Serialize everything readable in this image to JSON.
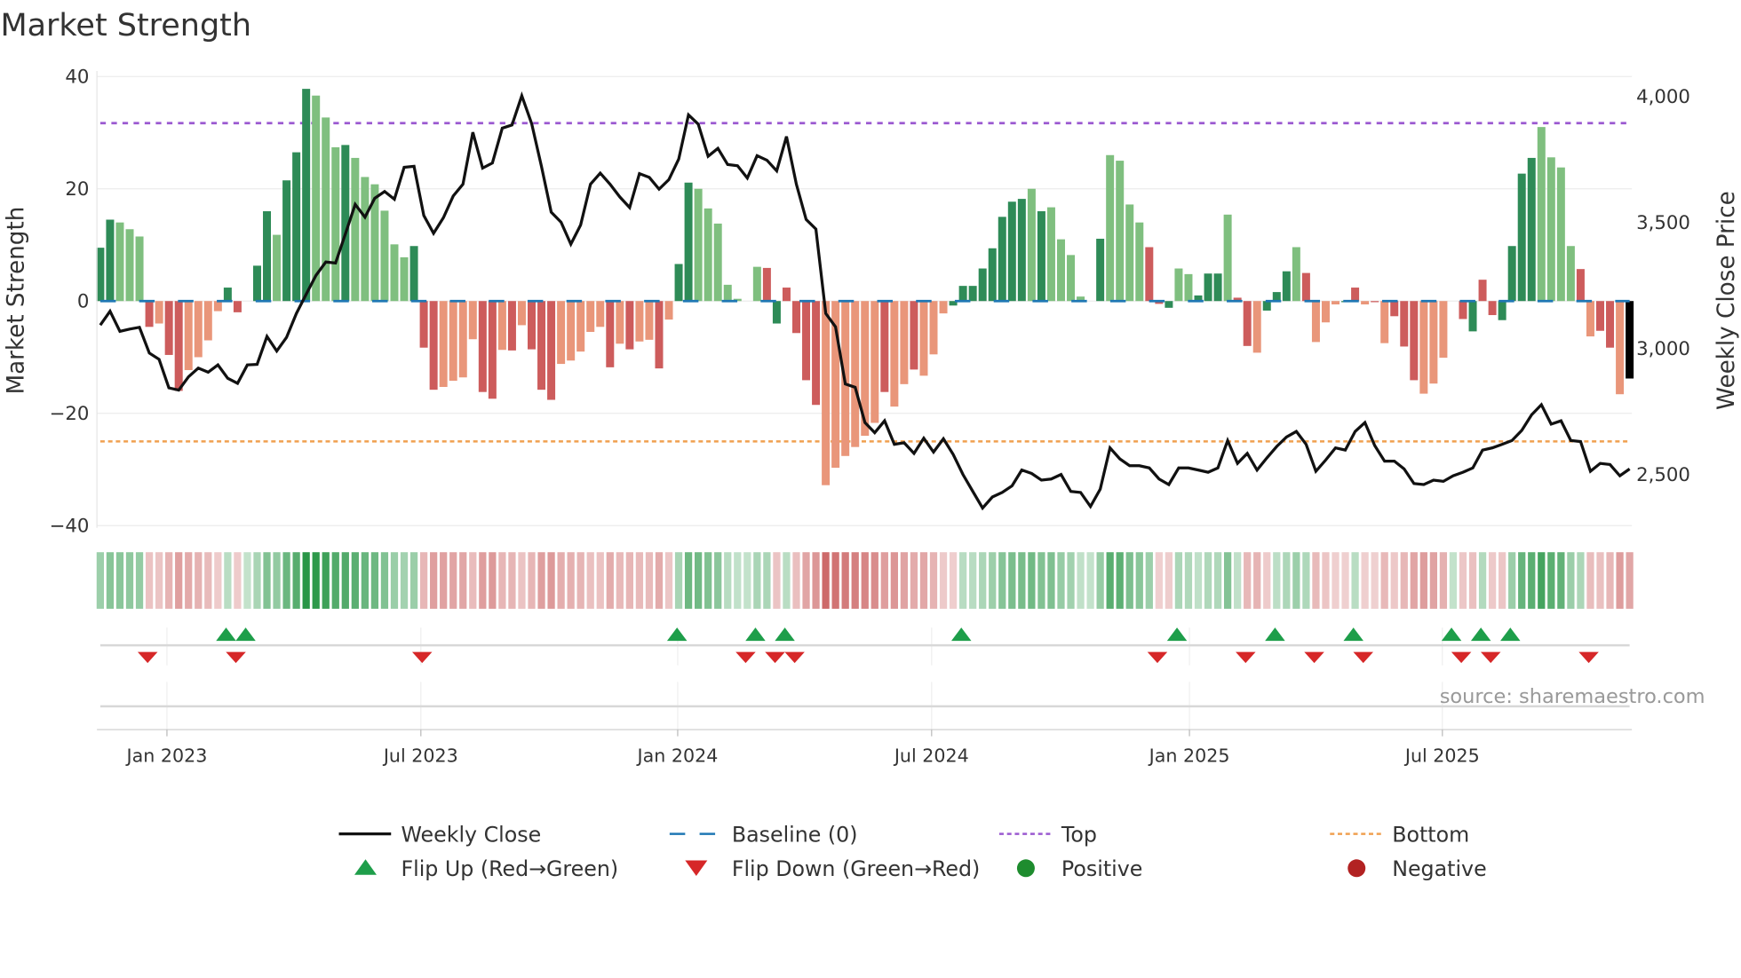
{
  "title": "Market Strength",
  "source": "source: sharemaestro.com",
  "chart_data": {
    "type": "bar+line",
    "title": "Market Strength",
    "ylabel": "Market Strength",
    "y2label": "Weekly Close Price",
    "ylim": [
      -40,
      40
    ],
    "y2lim": [
      2380,
      4080
    ],
    "yticks": [
      40,
      20,
      0,
      -20,
      -40
    ],
    "ytick_labels": [
      "40",
      "20",
      "0",
      "−20",
      "−40"
    ],
    "y2ticks": [
      4000,
      3500,
      3000,
      2500
    ],
    "y2tick_labels": [
      "4,000",
      "3,500",
      "3,000",
      "2,500"
    ],
    "x_unit": "week index (weekly, ~Nov 2022 to Oct 2025)",
    "xticks": [
      {
        "week": 6.8,
        "label": "Jan 2023"
      },
      {
        "week": 32.7,
        "label": "Jul 2023"
      },
      {
        "week": 58.9,
        "label": "Jan 2024"
      },
      {
        "week": 84.8,
        "label": "Jul 2024"
      },
      {
        "week": 111.1,
        "label": "Jan 2025"
      },
      {
        "week": 136.9,
        "label": "Jul 2025"
      }
    ],
    "top_level": 31.7,
    "bottom_level": -25,
    "baseline": 0,
    "strength": [
      9.5,
      14.5,
      14,
      12.8,
      11.5,
      -4.6,
      -4,
      -9.6,
      -16,
      -12.3,
      -10,
      -7,
      -1.8,
      2.4,
      -2,
      0,
      6.3,
      16,
      11.8,
      21.5,
      26.5,
      37.8,
      36.6,
      32.7,
      27.4,
      27.8,
      25.5,
      22.1,
      20.8,
      16.1,
      10.1,
      7.8,
      9.8,
      -8.3,
      -15.8,
      -15.3,
      -14.2,
      -13.6,
      -6.8,
      -16.2,
      -17.4,
      -8.7,
      -8.8,
      -4.3,
      -8.6,
      -15.8,
      -17.6,
      -11.2,
      -10.6,
      -9,
      -5.5,
      -4.6,
      -11.8,
      -7.6,
      -8.6,
      -7.2,
      -6.9,
      -12,
      -3.3,
      6.6,
      21.1,
      20,
      16.5,
      13.8,
      2.9,
      0.4,
      0,
      6.1,
      5.9,
      -4,
      2.4,
      -5.7,
      -14.1,
      -18.5,
      -32.8,
      -29.7,
      -27.6,
      -26,
      -24,
      -21.7,
      -16.2,
      -18.8,
      -14.8,
      -12.2,
      -13.3,
      -9.5,
      -2.2,
      -0.8,
      2.7,
      2.7,
      5.8,
      9.4,
      15,
      17.7,
      18.2,
      20,
      16,
      16.7,
      11,
      8.2,
      0.8,
      0,
      11.1,
      26,
      25,
      17.2,
      14,
      9.6,
      -0.5,
      -1.2,
      5.8,
      4.8,
      1,
      4.9,
      4.9,
      15.4,
      0.6,
      -8,
      -9.2,
      -1.7,
      1.6,
      5.3,
      9.6,
      5,
      -7.3,
      -3.8,
      -0.6,
      -0.2,
      2.4,
      -0.6,
      -0.2,
      -7.5,
      -2.7,
      -8.1,
      -14.1,
      -16.5,
      -14.7,
      -10.1,
      0,
      -3.2,
      -5.4,
      3.8,
      -2.5,
      -3.4,
      9.8,
      22.7,
      25.5,
      31,
      25.6,
      23.8,
      9.8,
      5.7,
      -6.3,
      -5.3,
      -8.3,
      -16.6,
      -13.8
    ],
    "bar_state": "GGgggRrRRrrrrGRGGGgGGGgggGggggggGRRrrrrRRrRrRRRrrrrrRrRrrRrGGgggggGgRGRRRRrrrrrrRrrRrrrGGGGGGGGgGggggGGggggRRGggGGGgRRrGGGgRrrrGRrRrRRRrrrRRGRRGGGGggggRrRRr",
    "bar_state_legend": {
      "G": "positive rising",
      "g": "positive falling",
      "R": "negative falling",
      "r": "negative rising"
    },
    "weekly_close": [
      3093,
      3148,
      3068,
      3077,
      3084,
      2982,
      2957,
      2844,
      2835,
      2888,
      2922,
      2906,
      2935,
      2882,
      2862,
      2935,
      2937,
      3048,
      2990,
      3044,
      3139,
      3215,
      3290,
      3343,
      3339,
      3454,
      3572,
      3521,
      3596,
      3623,
      3592,
      3719,
      3723,
      3528,
      3457,
      3519,
      3605,
      3652,
      3858,
      3716,
      3736,
      3874,
      3887,
      4003,
      3892,
      3723,
      3541,
      3501,
      3414,
      3490,
      3652,
      3696,
      3652,
      3601,
      3559,
      3694,
      3679,
      3632,
      3670,
      3752,
      3927,
      3890,
      3763,
      3794,
      3730,
      3725,
      3676,
      3765,
      3747,
      3705,
      3841,
      3652,
      3512,
      3474,
      3139,
      3086,
      2859,
      2846,
      2706,
      2666,
      2713,
      2620,
      2626,
      2584,
      2644,
      2589,
      2642,
      2580,
      2500,
      2433,
      2367,
      2411,
      2429,
      2455,
      2518,
      2504,
      2478,
      2482,
      2500,
      2433,
      2429,
      2373,
      2442,
      2606,
      2562,
      2535,
      2535,
      2526,
      2482,
      2460,
      2526,
      2526,
      2518,
      2509,
      2526,
      2635,
      2544,
      2584,
      2518,
      2566,
      2611,
      2649,
      2671,
      2620,
      2513,
      2558,
      2606,
      2597,
      2671,
      2706,
      2615,
      2553,
      2553,
      2522,
      2464,
      2460,
      2478,
      2473,
      2495,
      2509,
      2526,
      2597,
      2606,
      2620,
      2635,
      2675,
      2737,
      2777,
      2700,
      2713,
      2635,
      2631,
      2513,
      2544,
      2540,
      2495,
      2522
    ],
    "flip_up_weeks": [
      13,
      15,
      59,
      67,
      70,
      88,
      110,
      120,
      128,
      138,
      141,
      144
    ],
    "flip_down_weeks": [
      5,
      14,
      33,
      66,
      69,
      71,
      108,
      117,
      124,
      129,
      139,
      142,
      152
    ],
    "legend": [
      {
        "label": "Weekly Close",
        "kind": "line",
        "color": "#111111"
      },
      {
        "label": "Baseline (0)",
        "kind": "dash",
        "color": "#1f77b4"
      },
      {
        "label": "Top",
        "kind": "dot",
        "color": "#9b59d0"
      },
      {
        "label": "Bottom",
        "kind": "dot",
        "color": "#f0a050"
      },
      {
        "label": "Flip Up (Red→Green)",
        "kind": "tri-up",
        "color": "#1e9e4a"
      },
      {
        "label": "Flip Down (Green→Red)",
        "kind": "tri-down",
        "color": "#d62728"
      },
      {
        "label": "Positive",
        "kind": "dot-marker",
        "color": "#1e8c2e"
      },
      {
        "label": "Negative",
        "kind": "dot-marker",
        "color": "#b22222"
      }
    ],
    "legend_placement": "bottom",
    "colors": {
      "G": "#2e8b57",
      "g": "#7fbf7f",
      "R": "#cd5c5c",
      "r": "#e9967a"
    }
  }
}
